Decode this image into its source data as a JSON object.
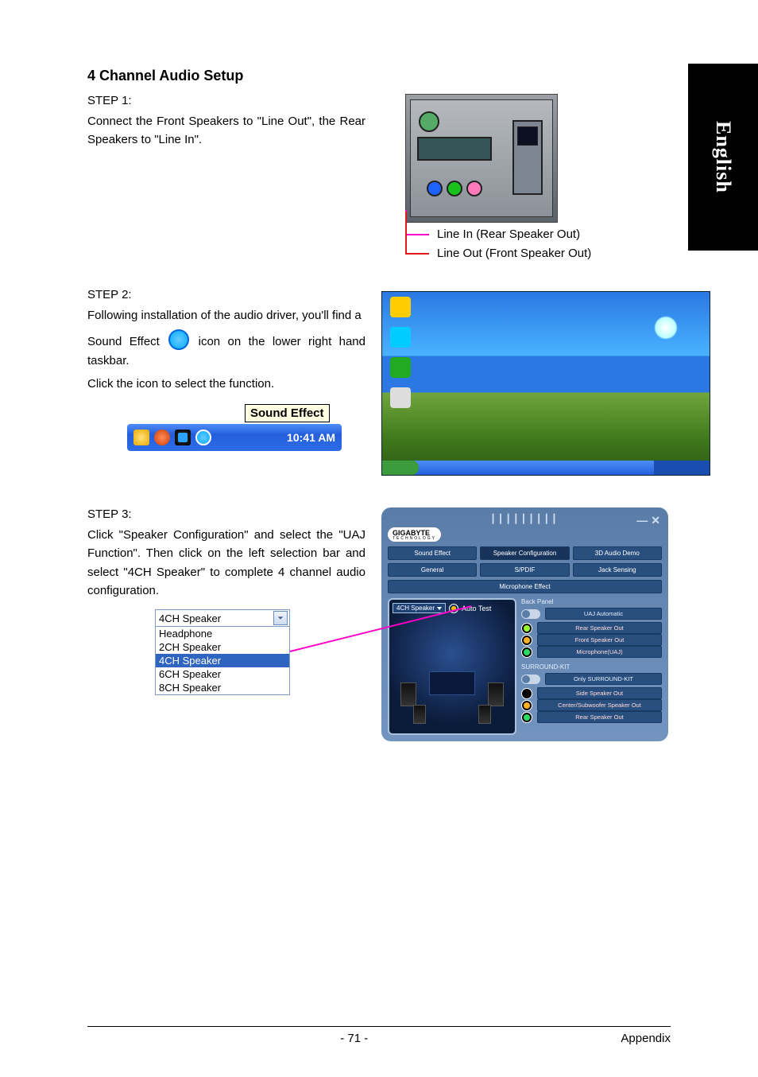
{
  "side_tab": "English",
  "title": "4 Channel Audio Setup",
  "step1": {
    "label": "STEP 1:",
    "text": "Connect the Front Speakers to \"Line Out\", the Rear Speakers to \"Line In\".",
    "callout_line_in": "Line In (Rear Speaker Out)",
    "callout_line_out": "Line Out (Front Speaker Out)"
  },
  "step2": {
    "label": "STEP 2:",
    "text_a": "Following installation of the audio driver, you'll find a",
    "text_b": "Sound Effect",
    "text_c": "icon on the lower right hand taskbar.",
    "text_d": "Click the icon to select the function.",
    "tooltip": "Sound Effect",
    "clock": "10:41 AM"
  },
  "step3": {
    "label": "STEP 3:",
    "text": "Click \"Speaker Configuration\" and select the \"UAJ Function\". Then click on the left selection bar and select \"4CH Speaker\" to complete 4 channel audio configuration.",
    "dropdown_current": "4CH Speaker",
    "dropdown_items": [
      "Headphone",
      "2CH Speaker",
      "4CH Speaker",
      "6CH Speaker",
      "8CH Speaker"
    ],
    "dropdown_selected_index": 2
  },
  "panel": {
    "brand": "GIGABYTE",
    "brand_sub": "TECHNOLOGY",
    "tabs_row1": [
      "Sound Effect",
      "Speaker Configuration",
      "3D Audio Demo",
      "General"
    ],
    "tabs_row2": [
      "S/PDIF",
      "Jack Sensing",
      "Microphone Effect"
    ],
    "active_tab_index": 1,
    "speaker_select": "4CH Speaker",
    "auto_test": "Auto Test",
    "back_panel": "Back Panel",
    "uaj_auto": "UAJ Automatic",
    "jacks_back": [
      "Rear Speaker Out",
      "Front Speaker Out",
      "Microphone(UAJ)"
    ],
    "surround_kit": "SURROUND-KIT",
    "only_sk": "Only SURROUND-KIT",
    "jacks_sk": [
      "Side Speaker Out",
      "Center/Subwoofer Speaker Out",
      "Rear Speaker Out"
    ]
  },
  "footer": {
    "page": "- 71 -",
    "section": "Appendix"
  }
}
